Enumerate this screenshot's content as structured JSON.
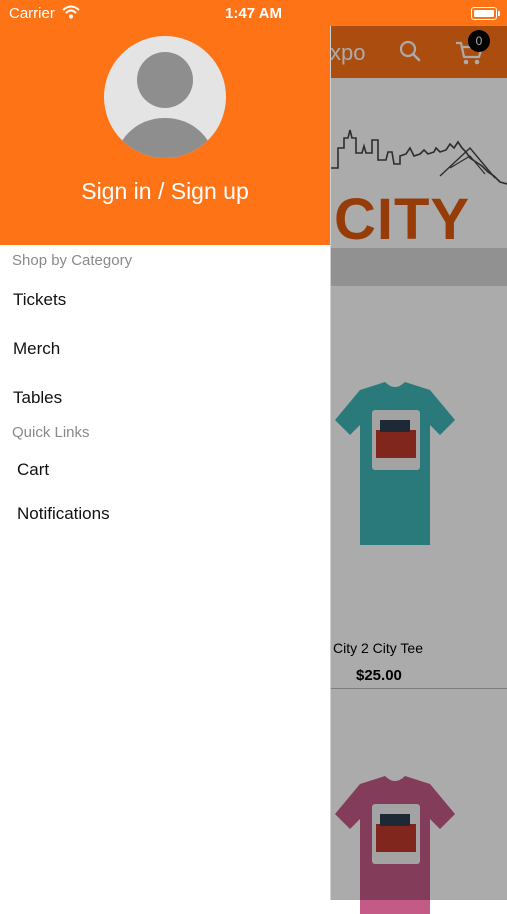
{
  "status_bar": {
    "carrier": "Carrier",
    "time": "1:47 AM"
  },
  "background": {
    "header_title": "xpo",
    "cart_count": "0",
    "banner_text": "CITY",
    "products": [
      {
        "name": "City 2 City Tee",
        "price": "$25.00",
        "shirt_color": "#3fb6b8"
      },
      {
        "name": "",
        "price": "",
        "shirt_color": "#c45a86"
      }
    ]
  },
  "colors": {
    "brand": "#ff7317",
    "avatar_bg": "#e4e4e4",
    "avatar_fg": "#8e8e8e"
  },
  "drawer": {
    "sign_in_label": "Sign in / Sign up",
    "sections": [
      {
        "title": "Shop by Category",
        "items": [
          "Tickets",
          "Merch",
          "Tables"
        ]
      },
      {
        "title": "Quick Links",
        "items": [
          "Cart",
          "Notifications"
        ]
      }
    ]
  }
}
